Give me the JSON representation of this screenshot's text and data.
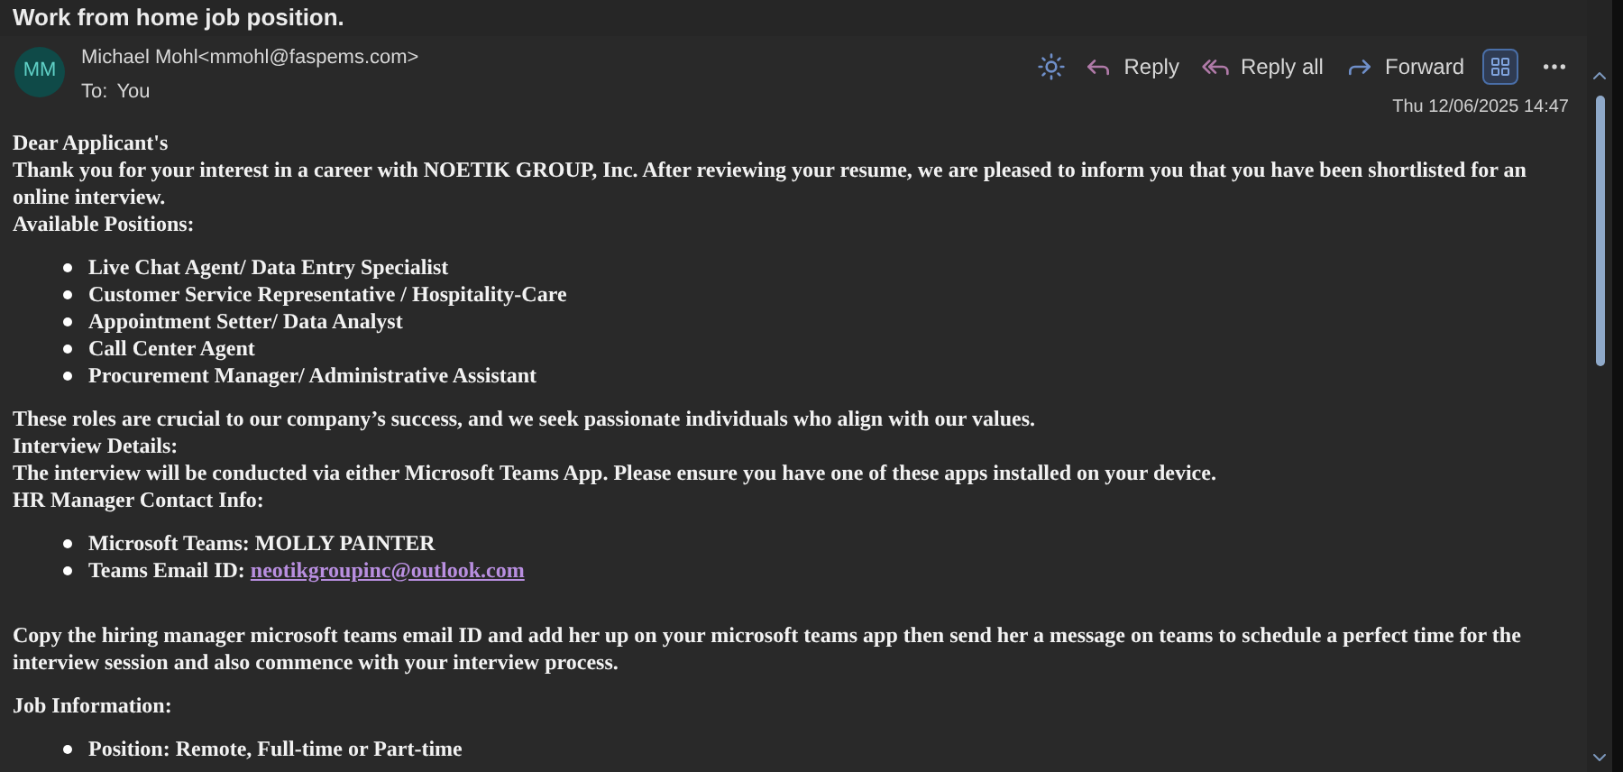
{
  "title": "Work from home job position.",
  "message": {
    "avatar": "MM",
    "sender": "Michael Mohl<mmohl@faspems.com>",
    "to_label": "To:",
    "to": "You",
    "date": "Thu 12/06/2025 14:47"
  },
  "actions": [
    {
      "kind": "theme"
    },
    {
      "kind": "reply",
      "label": "Reply"
    },
    {
      "kind": "reply_all",
      "label": "Reply all"
    },
    {
      "kind": "forward",
      "label": "Forward"
    },
    {
      "kind": "apps"
    },
    {
      "kind": "more"
    }
  ],
  "body": [
    {
      "kind": "lines",
      "lines": [
        "Dear Applicant's",
        "Thank you for your interest in a career with NOETIK GROUP, Inc. After reviewing your resume, we are pleased to inform you that you have been shortlisted for an online interview.",
        "Available Positions:"
      ]
    },
    {
      "kind": "list",
      "items": [
        {
          "text": "Live Chat Agent/ Data Entry Specialist"
        },
        {
          "text": "Customer Service Representative / Hospitality-Care"
        },
        {
          "text": "Appointment Setter/ Data Analyst"
        },
        {
          "text": "Call Center Agent"
        },
        {
          "text": "Procurement Manager/ Administrative Assistant"
        }
      ]
    },
    {
      "kind": "lines",
      "lines": [
        "These roles are crucial to our company’s success, and we seek passionate individuals who align with our values.",
        "Interview Details:",
        "The interview will be conducted via either Microsoft Teams App. Please ensure you have one of these apps installed on your device.",
        "HR Manager Contact Info:"
      ]
    },
    {
      "kind": "list",
      "items": [
        {
          "text": "Microsoft Teams: MOLLY PAINTER"
        },
        {
          "text": "Teams Email ID: ",
          "link": "neotikgroupinc@outlook.com"
        }
      ]
    },
    {
      "kind": "spacer"
    },
    {
      "kind": "lines",
      "lines": [
        "Copy the hiring manager microsoft teams email ID and add her up on your microsoft teams app then send her a message on teams to schedule a perfect time for the interview session and also commence with your interview process."
      ]
    },
    {
      "kind": "lines",
      "lines": [
        "Job Information:"
      ]
    },
    {
      "kind": "list",
      "items": [
        {
          "text": "Position: Remote, Full-time or Part-time"
        }
      ]
    }
  ]
}
